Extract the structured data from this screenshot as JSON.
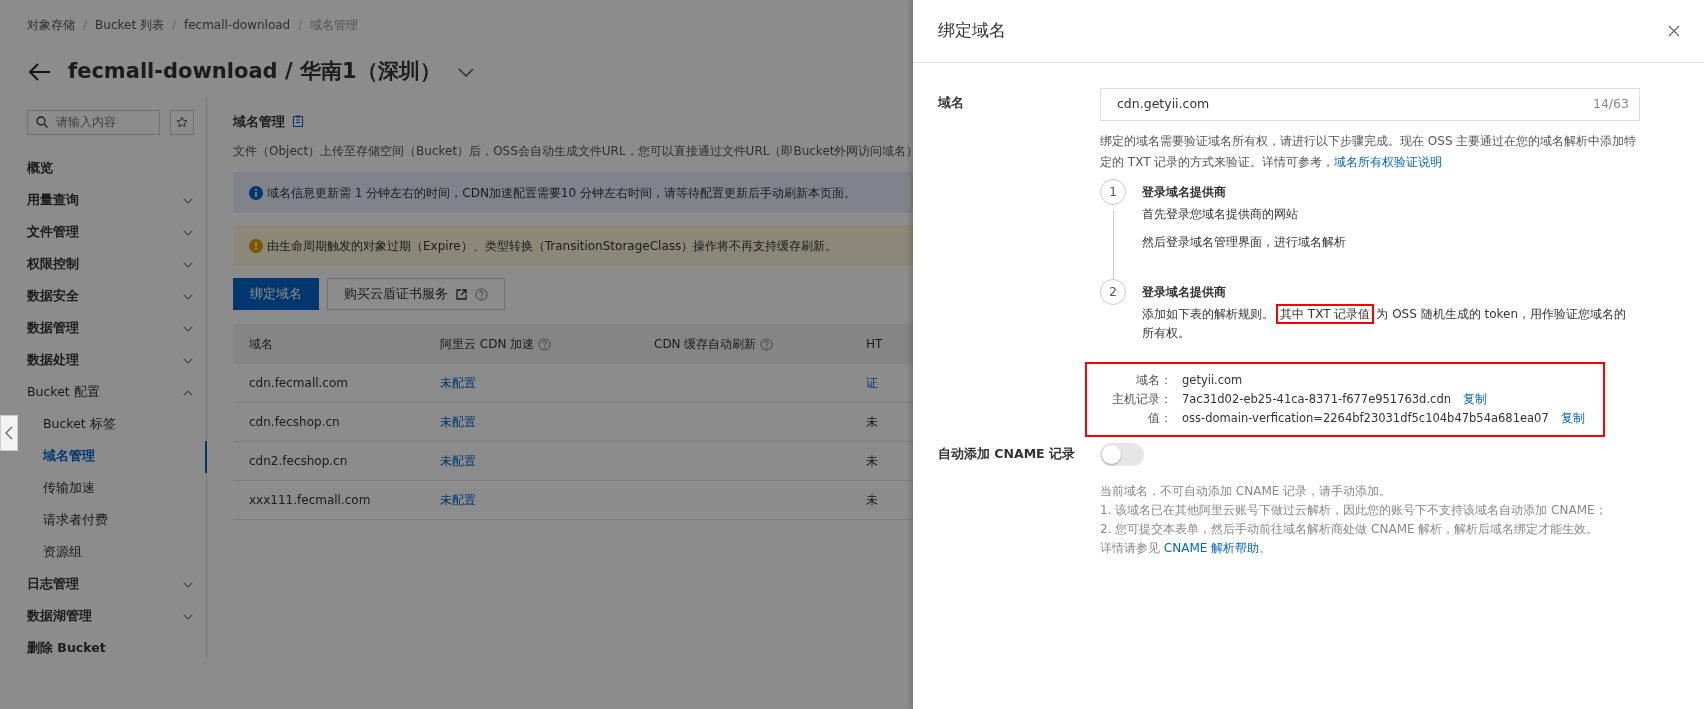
{
  "breadcrumb": [
    "对象存储",
    "Bucket 列表",
    "fecmall-download",
    "域名管理"
  ],
  "breadcrumb_separators": [
    "/",
    "/",
    "/"
  ],
  "page_title": "fecmall-download / 华南1（深圳）",
  "sidebar": {
    "search": {
      "placeholder": "请输入内容"
    },
    "items": [
      {
        "label": "概览",
        "kind": "link"
      },
      {
        "label": "用量查询",
        "kind": "group",
        "expanded": false
      },
      {
        "label": "文件管理",
        "kind": "group",
        "expanded": false
      },
      {
        "label": "权限控制",
        "kind": "group",
        "expanded": false
      },
      {
        "label": "数据安全",
        "kind": "group",
        "expanded": false
      },
      {
        "label": "数据管理",
        "kind": "group",
        "expanded": false
      },
      {
        "label": "数据处理",
        "kind": "group",
        "expanded": false
      },
      {
        "label": "Bucket 配置",
        "kind": "group",
        "expanded": true,
        "children": [
          {
            "label": "Bucket 标签",
            "selected": false
          },
          {
            "label": "域名管理",
            "selected": true
          },
          {
            "label": "传输加速",
            "selected": false
          },
          {
            "label": "请求者付费",
            "selected": false
          },
          {
            "label": "资源组",
            "selected": false
          }
        ]
      },
      {
        "label": "日志管理",
        "kind": "group",
        "expanded": false
      },
      {
        "label": "数据湖管理",
        "kind": "group",
        "expanded": false
      },
      {
        "label": "删除 Bucket",
        "kind": "link"
      }
    ]
  },
  "content": {
    "heading": "域名管理",
    "description": "文件（Object）上传至存储空间（Bucket）后，OSS会自动生成文件URL，您可以直接通过文件URL（即Bucket外网访问域名）",
    "alerts": [
      {
        "kind": "info",
        "text": "域名信息更新需 1 分钟左右的时间，CDN加速配置需要10 分钟左右时间，请等待配置更新后手动刷新本页面。"
      },
      {
        "kind": "warning",
        "text": "由生命周期触发的对象过期（Expire）、类型转换（TransitionStorageClass）操作将不再支持缓存刷新。"
      }
    ],
    "buttons": [
      {
        "label": "绑定域名",
        "kind": "primary"
      },
      {
        "label": "购买云盾证书服务",
        "kind": "external"
      }
    ],
    "table": {
      "columns": [
        {
          "label": "域名",
          "help": false
        },
        {
          "label": "阿里云 CDN 加速",
          "help": true
        },
        {
          "label": "CDN 缓存自动刷新",
          "help": true
        },
        {
          "label": "HT",
          "help": false
        }
      ],
      "rows": [
        {
          "domain": "cdn.fecmall.com",
          "cdn": "未配置",
          "column_4": "证",
          "column_4_link": true
        },
        {
          "domain": "cdn.fecshop.cn",
          "cdn": "未配置",
          "column_4": "未",
          "column_4_link": false
        },
        {
          "domain": "cdn2.fecshop.cn",
          "cdn": "未配置",
          "column_4": "未",
          "column_4_link": false
        },
        {
          "domain": "xxx111.fecmall.com",
          "cdn": "未配置",
          "column_4": "未",
          "column_4_link": false
        }
      ]
    }
  },
  "drawer": {
    "title": "绑定域名",
    "domain_field": {
      "label": "域名",
      "value": "cdn.getyii.com",
      "counter": "14/63"
    },
    "intro": "绑定的域名需要验证域名所有权，请进行以下步骤完成。现在 OSS 主要通过在您的域名解析中添加特定的 TXT 记录的方式来验证。详情可参考，",
    "intro_link": "域名所有权验证说明",
    "steps": [
      {
        "number": "1",
        "title": "登录域名提供商",
        "lines": [
          "首先登录您域名提供商的网站",
          "然后登录域名管理界面，进行域名解析"
        ]
      },
      {
        "number": "2",
        "title": "登录域名提供商",
        "segments": [
          [
            {
              "text": "添加如下表的解析规则。",
              "highlighted": false
            },
            {
              "text": "其中 TXT 记录值",
              "highlighted": true
            },
            {
              "text": "为 OSS 随机生成的 token，用作验证您域名的所有权。",
              "highlighted": false
            }
          ]
        ]
      }
    ],
    "records": {
      "highlighted": true,
      "items": [
        {
          "label": "域名：",
          "value": "getyii.com"
        },
        {
          "label": "主机记录：",
          "value": "7ac31d02-eb25-41ca-8371-f677e951763d.cdn",
          "action": "复制"
        },
        {
          "label": "值：",
          "value": "oss-domain-verfication=2264bf23031df5c104b47b54a681ea07",
          "action": "复制"
        }
      ]
    },
    "cname": {
      "label": "自动添加 CNAME 记录",
      "on": false,
      "notes": [
        "当前域名，不可自动添加 CNAME 记录，请手动添加。",
        "1. 该域名已在其他阿里云账号下做过云解析，因此您的账号下不支持该域名自动添加 CNAME；",
        "2. 您可提交本表单，然后手动前往域名解析商处做 CNAME 解析，解析后域名绑定才能生效。"
      ],
      "help": {
        "text": "详情请参见 ",
        "link": "CNAME 解析帮助",
        "tail": "。"
      }
    }
  }
}
